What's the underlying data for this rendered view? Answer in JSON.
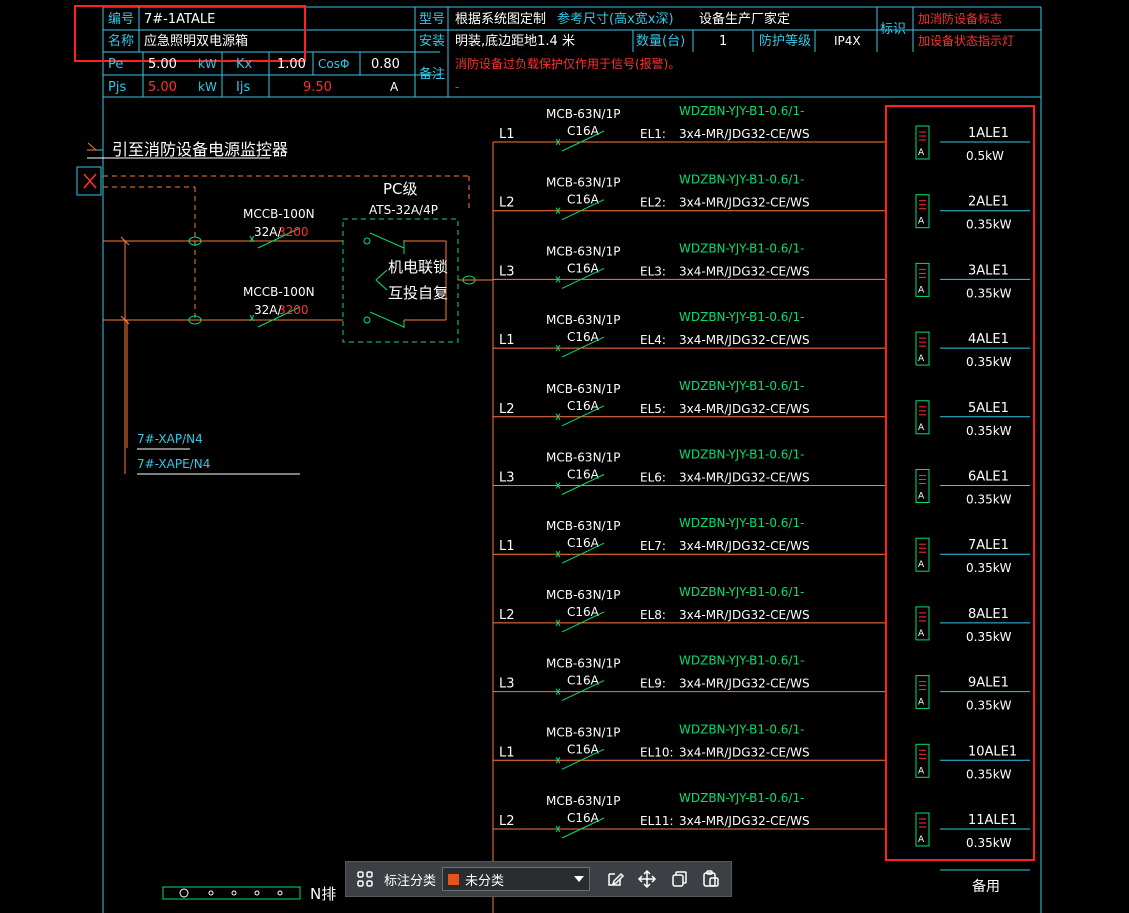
{
  "header": {
    "number_label": "编号",
    "number_value": "7#-1ATALE",
    "name_label": "名称",
    "name_value": "应急照明双电源箱",
    "model_label": "型号",
    "model_value": "根据系统图定制",
    "ref_size": "参考尺寸(高x宽x深)",
    "manufacturer": "设备生产厂家定",
    "id_label": "标识",
    "id_note_1": "加消防设备标志",
    "id_note_2": "加设备状态指示灯",
    "install_label": "安装",
    "install_value": "明装,底边距地1.4 米",
    "qty_label": "数量(台)",
    "qty_value": "1",
    "protect_label": "防护等级",
    "protect_value": "IP4X",
    "remark_label": "备注",
    "remark_value": "消防设备过负载保护仅作用于信号(报警)。",
    "remark_dash": "-",
    "pe_label": "Pe",
    "pe_value": "5.00",
    "pe_unit": "kW",
    "kx_label": "Kx",
    "kx_value": "1.00",
    "cos_label": "CosΦ",
    "cos_value": "0.80",
    "pjs_label": "Pjs",
    "pjs_value": "5.00",
    "pjs_unit": "kW",
    "ijs_label": "Ijs",
    "ijs_value": "9.50",
    "ijs_unit": "A"
  },
  "diagram": {
    "monitor_text": "引至消防设备电源监控器",
    "pc_level": "PC级",
    "ats_model": "ATS-32A/4P",
    "interlock_1": "机电联锁",
    "interlock_2": "互投自复",
    "mccb_1_model": "MCCB-100N",
    "mccb_1_rating": "32A/",
    "mccb_1_trip": "3200",
    "mccb_2_model": "MCCB-100N",
    "mccb_2_rating": "32A/",
    "mccb_2_trip": "3200",
    "supply_1": "7#-XAP/N4",
    "supply_2": "7#-XAPE/N4",
    "n_bar": "N排",
    "spare": "备用"
  },
  "circuits": [
    {
      "phase": "L1",
      "breaker": "MCB-63N/1P",
      "rating": "C16A",
      "label": "EL1:",
      "cable_1": "WDZBN-YJY-B1-0.6/1-",
      "cable_2": "3x4-MR/JDG32-CE/WS",
      "load": "1ALE1",
      "power": "0.5kW"
    },
    {
      "phase": "L2",
      "breaker": "MCB-63N/1P",
      "rating": "C16A",
      "label": "EL2:",
      "cable_1": "WDZBN-YJY-B1-0.6/1-",
      "cable_2": "3x4-MR/JDG32-CE/WS",
      "load": "2ALE1",
      "power": "0.35kW"
    },
    {
      "phase": "L3",
      "breaker": "MCB-63N/1P",
      "rating": "C16A",
      "label": "EL3:",
      "cable_1": "WDZBN-YJY-B1-0.6/1-",
      "cable_2": "3x4-MR/JDG32-CE/WS",
      "load": "3ALE1",
      "power": "0.35kW"
    },
    {
      "phase": "L1",
      "breaker": "MCB-63N/1P",
      "rating": "C16A",
      "label": "EL4:",
      "cable_1": "WDZBN-YJY-B1-0.6/1-",
      "cable_2": "3x4-MR/JDG32-CE/WS",
      "load": "4ALE1",
      "power": "0.35kW"
    },
    {
      "phase": "L2",
      "breaker": "MCB-63N/1P",
      "rating": "C16A",
      "label": "EL5:",
      "cable_1": "WDZBN-YJY-B1-0.6/1-",
      "cable_2": "3x4-MR/JDG32-CE/WS",
      "load": "5ALE1",
      "power": "0.35kW"
    },
    {
      "phase": "L3",
      "breaker": "MCB-63N/1P",
      "rating": "C16A",
      "label": "EL6:",
      "cable_1": "WDZBN-YJY-B1-0.6/1-",
      "cable_2": "3x4-MR/JDG32-CE/WS",
      "load": "6ALE1",
      "power": "0.35kW"
    },
    {
      "phase": "L1",
      "breaker": "MCB-63N/1P",
      "rating": "C16A",
      "label": "EL7:",
      "cable_1": "WDZBN-YJY-B1-0.6/1-",
      "cable_2": "3x4-MR/JDG32-CE/WS",
      "load": "7ALE1",
      "power": "0.35kW"
    },
    {
      "phase": "L2",
      "breaker": "MCB-63N/1P",
      "rating": "C16A",
      "label": "EL8:",
      "cable_1": "WDZBN-YJY-B1-0.6/1-",
      "cable_2": "3x4-MR/JDG32-CE/WS",
      "load": "8ALE1",
      "power": "0.35kW"
    },
    {
      "phase": "L3",
      "breaker": "MCB-63N/1P",
      "rating": "C16A",
      "label": "EL9:",
      "cable_1": "WDZBN-YJY-B1-0.6/1-",
      "cable_2": "3x4-MR/JDG32-CE/WS",
      "load": "9ALE1",
      "power": "0.35kW"
    },
    {
      "phase": "L1",
      "breaker": "MCB-63N/1P",
      "rating": "C16A",
      "label": "EL10:",
      "cable_1": "WDZBN-YJY-B1-0.6/1-",
      "cable_2": "3x4-MR/JDG32-CE/WS",
      "load": "10ALE1",
      "power": "0.35kW"
    },
    {
      "phase": "L2",
      "breaker": "MCB-63N/1P",
      "rating": "C16A",
      "label": "EL11:",
      "cable_1": "WDZBN-YJY-B1-0.6/1-",
      "cable_2": "3x4-MR/JDG32-CE/WS",
      "load": "11ALE1",
      "power": "0.35kW"
    }
  ],
  "module_letter": "A",
  "toolbar": {
    "grid_icon": "grid-icon",
    "label": "标注分类",
    "select_value": "未分类",
    "select_color": "#e8531a",
    "edit_icon": "edit-icon",
    "move_icon": "move-icon",
    "copy_icon": "copy-icon",
    "paste_icon": "paste-icon"
  },
  "colors": {
    "frame": "#33c8e8",
    "wire": "#ff7a3c",
    "device": "#00e070",
    "highlight": "#ff2020",
    "text": "#ffffff"
  }
}
